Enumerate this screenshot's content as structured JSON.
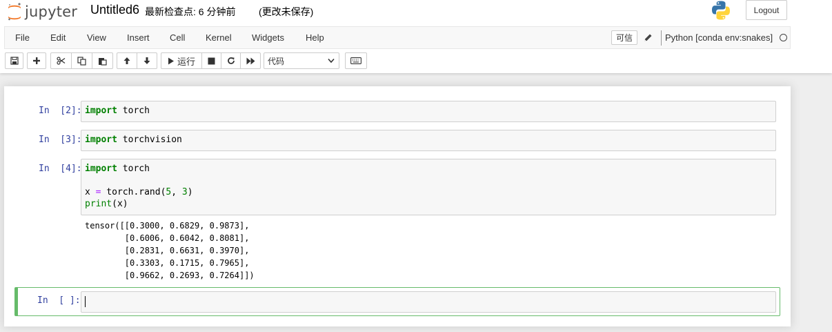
{
  "header": {
    "logo_text": "jupyter",
    "notebook_name": "Untitled6",
    "checkpoint": "最新检查点: 6 分钟前",
    "autosave": "(更改未保存)",
    "logout": "Logout"
  },
  "menubar": {
    "items": [
      "File",
      "Edit",
      "View",
      "Insert",
      "Cell",
      "Kernel",
      "Widgets",
      "Help"
    ],
    "trusted": "可信",
    "kernel": "Python [conda env:snakes]"
  },
  "toolbar": {
    "run_label": "运行",
    "cell_type": "代码"
  },
  "cells": [
    {
      "prompt": "In  [2]:",
      "code": [
        [
          {
            "t": "import",
            "c": "kw"
          },
          {
            "t": " torch"
          }
        ]
      ]
    },
    {
      "prompt": "In  [3]:",
      "code": [
        [
          {
            "t": "import",
            "c": "kw"
          },
          {
            "t": " torchvision"
          }
        ]
      ]
    },
    {
      "prompt": "In  [4]:",
      "code": [
        [
          {
            "t": "import",
            "c": "kw"
          },
          {
            "t": " torch"
          }
        ],
        [],
        [
          {
            "t": "x "
          },
          {
            "t": "=",
            "c": "op"
          },
          {
            "t": " torch.rand("
          },
          {
            "t": "5",
            "c": "num"
          },
          {
            "t": ", "
          },
          {
            "t": "3",
            "c": "num"
          },
          {
            "t": ")"
          }
        ],
        [
          {
            "t": "print",
            "c": "kw2"
          },
          {
            "t": "(x)"
          }
        ]
      ],
      "output": "tensor([[0.3000, 0.6829, 0.9873],\n        [0.6006, 0.6042, 0.8081],\n        [0.2831, 0.6631, 0.3970],\n        [0.3303, 0.1715, 0.7965],\n        [0.9662, 0.2693, 0.7264]])"
    },
    {
      "prompt": "In  [ ]:",
      "code": []
    }
  ],
  "colors": {
    "prompt": "#303f9f",
    "keyword": "#008000",
    "operator": "#aa22ff",
    "selected_border": "#66bb6a",
    "logo_orange": "#f37726"
  }
}
